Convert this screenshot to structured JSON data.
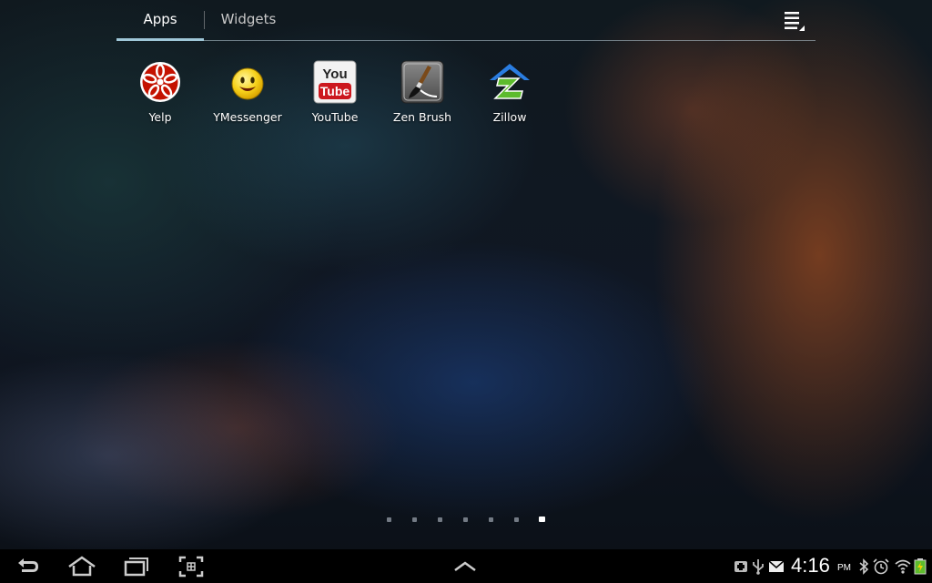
{
  "tabs": {
    "apps": "Apps",
    "widgets": "Widgets"
  },
  "apps": [
    {
      "label": "Yelp",
      "icon": "yelp-icon"
    },
    {
      "label": "YMessenger",
      "icon": "ymessenger-icon"
    },
    {
      "label": "YouTube",
      "icon": "youtube-icon"
    },
    {
      "label": "Zen Brush",
      "icon": "zen-brush-icon"
    },
    {
      "label": "Zillow",
      "icon": "zillow-icon"
    }
  ],
  "youtube_logo": {
    "top": "You",
    "bottom": "Tube"
  },
  "pager": {
    "count": 7,
    "active_index": 6
  },
  "status": {
    "time": "4:16",
    "ampm": "PM"
  },
  "colors": {
    "tab_indicator": "#9fc7d8",
    "yelp_red": "#c41200",
    "youtube_red": "#cc181e",
    "zillow_blue": "#2a7de1",
    "zillow_green": "#5dbb2d"
  }
}
